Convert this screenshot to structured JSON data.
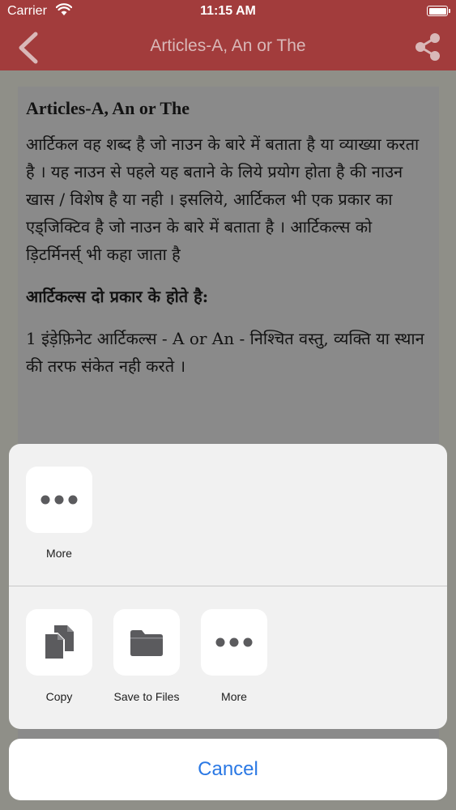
{
  "statusbar": {
    "carrier": "Carrier",
    "time": "11:15 AM"
  },
  "navbar": {
    "title": "Articles-A, An or The"
  },
  "content": {
    "heading": "Articles-A, An or The",
    "p1": "आर्टिकल वह शब्द है जो नाउन के बारे में बताता है या व्याख्या करता है । यह नाउन से पहले यह बताने के लिये प्रयोग होता है की नाउन खास / विशेष है या नही । इसलिये, आर्टिकल भी एक प्रकार का एड्जिक्टिव है जो नाउन के बारे में बताता है । आर्टिकल्स को ड़िटर्मिनर्स् भी कहा जाता है",
    "subhead": "आर्टिकल्स दो प्रकार के होते है:",
    "p2": "1 इंड़ेफ़िनेट आर्टिकल्स - A or An - निश्चित वस्तु, व्यक्ति या स्थान की तरफ संकेत नही करते ।"
  },
  "share_sheet": {
    "row1": [
      {
        "label": "More",
        "icon": "ellipsis-icon"
      }
    ],
    "row2": [
      {
        "label": "Copy",
        "icon": "copy-icon"
      },
      {
        "label": "Save to Files",
        "icon": "folder-icon"
      },
      {
        "label": "More",
        "icon": "ellipsis-icon"
      }
    ]
  },
  "cancel_label": "Cancel",
  "colors": {
    "nav": "#a23c3c",
    "accent": "#2a78e4",
    "icon": "#5b5b5e"
  }
}
